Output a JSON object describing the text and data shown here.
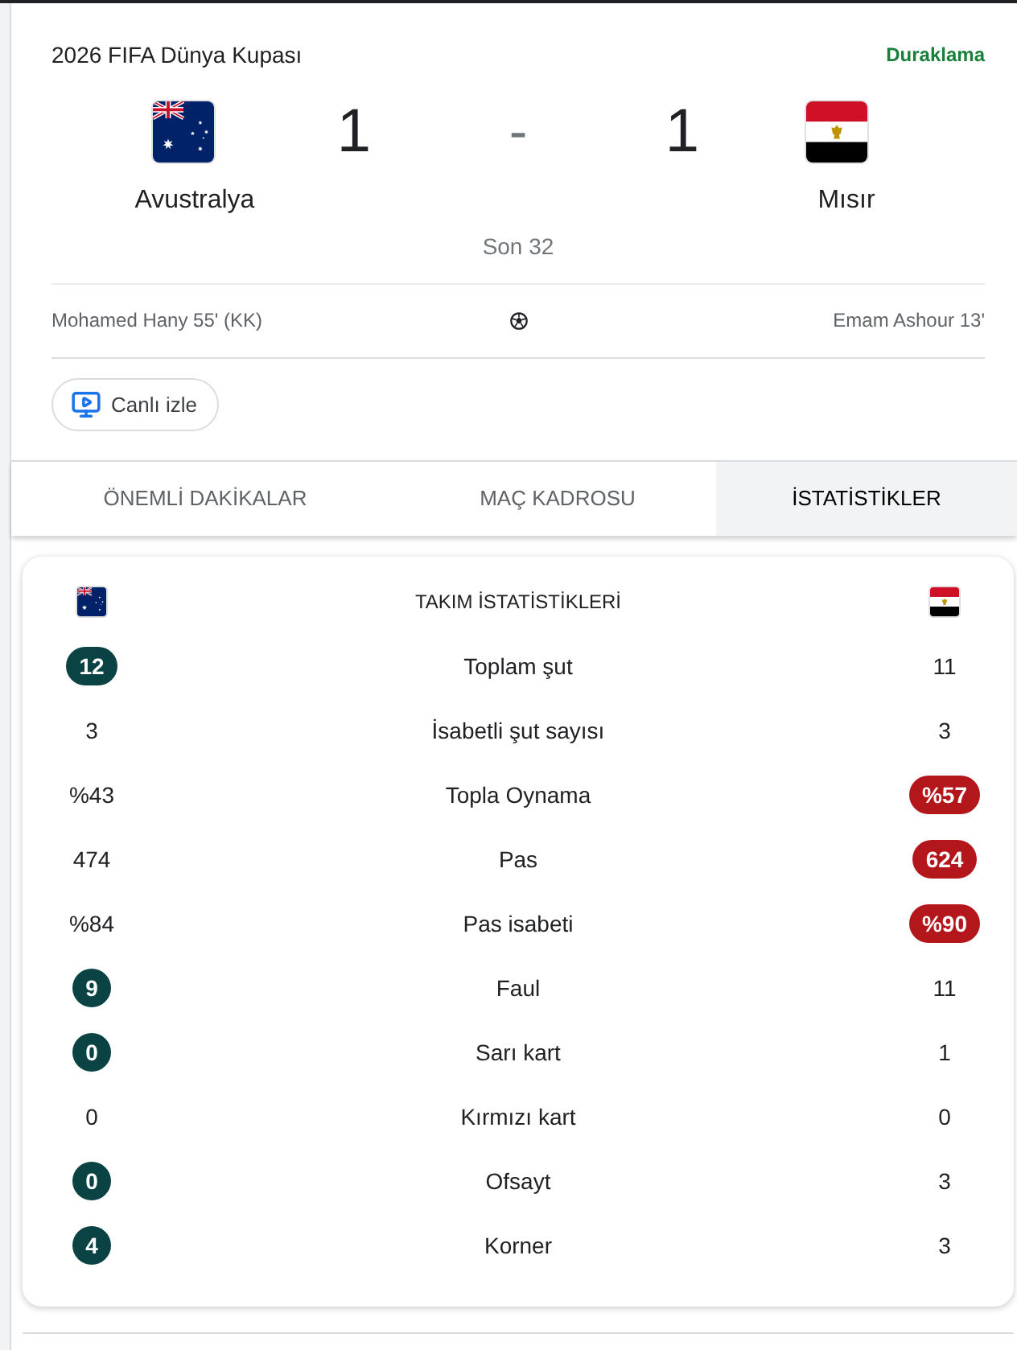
{
  "competition": "2026 FIFA Dünya Kupası",
  "status": "Duraklama",
  "teams": [
    {
      "name": "Avustralya",
      "score": "1",
      "color": "#0b4344",
      "kind": "australia"
    },
    {
      "name": "Mısır",
      "score": "1",
      "color": "#b3161b",
      "kind": "egypt"
    }
  ],
  "score_separator": "-",
  "round": "Son 32",
  "goals": [
    {
      "text": "Mohamed Hany 55' (KK)"
    },
    {
      "text": "Emam Ashour 13'"
    }
  ],
  "watch_button": {
    "label": "Canlı izle"
  },
  "tabs": [
    {
      "label": "ÖNEMLİ DAKİKALAR",
      "selected": false
    },
    {
      "label": "MAÇ KADROSU",
      "selected": false
    },
    {
      "label": "İSTATİSTİKLER",
      "selected": true
    }
  ],
  "stats": {
    "title": "TAKIM İSTATİSTİKLERİ",
    "rows": [
      {
        "label": "Toplam şut",
        "values": [
          {
            "text": "12",
            "highlighted": true
          },
          {
            "text": "11",
            "highlighted": false
          }
        ]
      },
      {
        "label": "İsabetli şut sayısı",
        "values": [
          {
            "text": "3",
            "highlighted": false
          },
          {
            "text": "3",
            "highlighted": false
          }
        ]
      },
      {
        "label": "Topla Oynama",
        "values": [
          {
            "text": "%43",
            "highlighted": false
          },
          {
            "text": "%57",
            "highlighted": true
          }
        ]
      },
      {
        "label": "Pas",
        "values": [
          {
            "text": "474",
            "highlighted": false
          },
          {
            "text": "624",
            "highlighted": true
          }
        ]
      },
      {
        "label": "Pas isabeti",
        "values": [
          {
            "text": "%84",
            "highlighted": false
          },
          {
            "text": "%90",
            "highlighted": true
          }
        ]
      },
      {
        "label": "Faul",
        "values": [
          {
            "text": "9",
            "highlighted": true
          },
          {
            "text": "11",
            "highlighted": false
          }
        ]
      },
      {
        "label": "Sarı kart",
        "values": [
          {
            "text": "0",
            "highlighted": true
          },
          {
            "text": "1",
            "highlighted": false
          }
        ]
      },
      {
        "label": "Kırmızı kart",
        "values": [
          {
            "text": "0",
            "highlighted": false
          },
          {
            "text": "0",
            "highlighted": false
          }
        ]
      },
      {
        "label": "Ofsayt",
        "values": [
          {
            "text": "0",
            "highlighted": true
          },
          {
            "text": "3",
            "highlighted": false
          }
        ]
      },
      {
        "label": "Korner",
        "values": [
          {
            "text": "4",
            "highlighted": true
          },
          {
            "text": "3",
            "highlighted": false
          }
        ]
      }
    ]
  }
}
